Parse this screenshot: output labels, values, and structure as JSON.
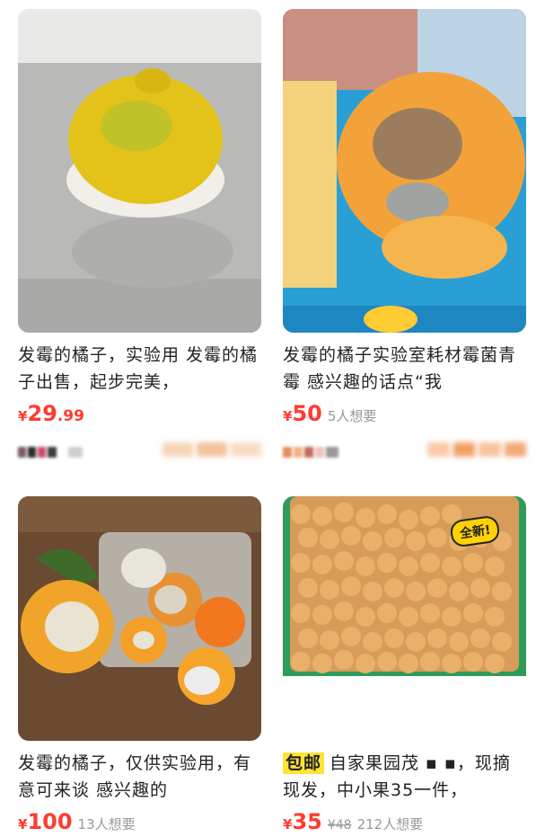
{
  "items": [
    {
      "title": "发霉的橘子，实验用 发霉的橘子出售，起步完美，",
      "price_symbol": "¥",
      "price_int": "29",
      "price_dec": ".99",
      "wants": "",
      "image": "moldy-orange-on-steel-photo"
    },
    {
      "title": "发霉的橘子实验室耗材霉菌青霉 感兴趣的话点“我",
      "price_symbol": "¥",
      "price_int": "50",
      "price_dec": "",
      "wants": "5人想要",
      "image": "hand-holding-moldy-orange-photo"
    },
    {
      "title": "发霉的橘子，仅供实验用，有意可来谈 感兴趣的",
      "price_symbol": "¥",
      "price_int": "100",
      "price_dec": "",
      "wants": "13人想要",
      "image": "moldy-oranges-on-table-photo"
    },
    {
      "tag": "包邮",
      "title": "自家果园茂 ▪ ▪，现摘现发，中小果35一件，",
      "price_symbol": "¥",
      "price_int": "35",
      "price_dec": "",
      "old_price": "¥48",
      "wants": "212人想要",
      "badge": "全新!",
      "image": "basket-of-small-oranges-photo"
    }
  ],
  "colors": {
    "price": "#ff3b30",
    "badge": "#ffd200",
    "tag_bg": "#ffe433"
  }
}
